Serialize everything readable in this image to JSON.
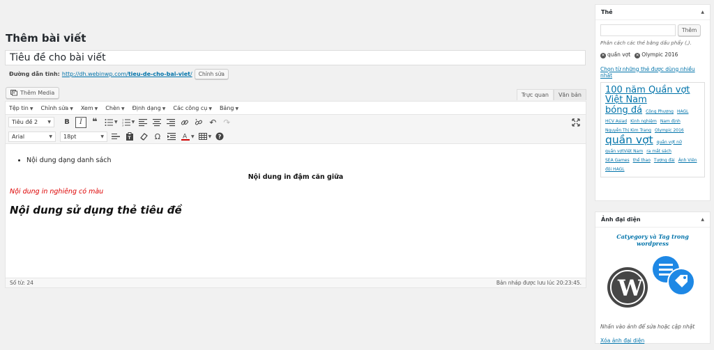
{
  "page_title": "Thêm bài viết",
  "title_input": {
    "value": "Tiêu đề cho bài viết"
  },
  "permalink": {
    "label": "Đường dẫn tĩnh:",
    "url_base": "http://dh.webinwp.com/",
    "slug": "tieu-de-cho-bai-viet",
    "url_end": "/",
    "edit_button": "Chỉnh sửa"
  },
  "media_button": "Thêm Media",
  "mode_tabs": {
    "visual": "Trực quan",
    "text": "Văn bản"
  },
  "menubar": [
    "Tệp tin",
    "Chỉnh sửa",
    "Xem",
    "Chèn",
    "Định dạng",
    "Các công cụ",
    "Bảng"
  ],
  "toolbar": {
    "format_select": "Tiêu đề 2",
    "font_select": "Arial",
    "size_select": "18pt",
    "text_color": "#d00000"
  },
  "content": {
    "list_item": "Nội dung dạng danh sách",
    "bold_center": "Nội dung in đậm căn giữa",
    "red_italic": "Nội dung in nghiêng có màu",
    "heading": "Nội dung sử dụng thẻ tiêu đề"
  },
  "status": {
    "word_count": "Số từ: 24",
    "draft_saved": "Bản nháp được lưu lúc 20:23:45."
  },
  "tags_box": {
    "title": "Thẻ",
    "add_button": "Thêm",
    "hint": "Phân cách các thẻ bằng dấu phẩy (,).",
    "current_tags": [
      "quần vợt",
      "Olympic 2016"
    ],
    "choose_link": "Chọn từ những thẻ được dùng nhiều nhất",
    "cloud": [
      {
        "text": "100 năm Quần vợt Việt Nam",
        "size": "big"
      },
      {
        "text": "bóng đá",
        "size": "big"
      },
      {
        "text": "Công Phượng",
        "size": "t1"
      },
      {
        "text": "HAGL",
        "size": "t1"
      },
      {
        "text": "HCV Asiad",
        "size": "t1"
      },
      {
        "text": "Kinh nghiệm",
        "size": "t1"
      },
      {
        "text": "Nam định",
        "size": "t1"
      },
      {
        "text": "Nguyễn Thị Kim Trang",
        "size": "t1"
      },
      {
        "text": "Olympic 2016",
        "size": "t1"
      },
      {
        "text": "quần vợt",
        "size": "xl"
      },
      {
        "text": "quần vợt nữ",
        "size": "t1"
      },
      {
        "text": "quần vợtViệt Nam",
        "size": "t1"
      },
      {
        "text": "ra mắt sách",
        "size": "t1"
      },
      {
        "text": "SEA Games",
        "size": "t1"
      },
      {
        "text": "thể thao",
        "size": "t1"
      },
      {
        "text": "Tượng đài",
        "size": "t1"
      },
      {
        "text": "Ánh Viên",
        "size": "t1"
      },
      {
        "text": "đội HAGL",
        "size": "t1"
      }
    ]
  },
  "featured_box": {
    "title": "Ảnh đại diện",
    "image_caption": "Catyegory và Tag trong wordpress",
    "note": "Nhấn vào ảnh để sửa hoặc cập nhật",
    "remove_link": "Xóa ảnh đại diện"
  },
  "colors": {
    "link": "#0073aa",
    "accent_blue": "#1e88e5",
    "wp_dark": "#464646"
  }
}
